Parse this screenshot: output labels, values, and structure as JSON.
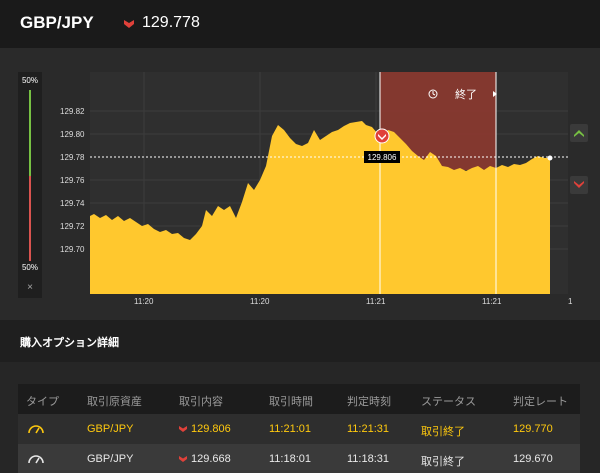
{
  "header": {
    "pair": "GBP/JPY",
    "rate": "129.778",
    "rate_direction": "down",
    "down_color": "#e0413a"
  },
  "gauge": {
    "top_label": "50%",
    "bottom_label": "50%",
    "close": "×",
    "up_fraction": 0.5,
    "down_fraction": 0.5
  },
  "chart": {
    "y_ticks": [
      "129.82",
      "129.80",
      "129.78",
      "129.76",
      "129.74",
      "129.72",
      "129.70"
    ],
    "x_ticks": [
      "11:20",
      "11:20",
      "11:21",
      "11:21"
    ],
    "window_label": "終了",
    "entry_label": "129.806",
    "area_color": "#ffc82e",
    "window_color": "#8b3a30"
  },
  "side_buttons": {
    "up_color": "#77c043",
    "down_color": "#e0413a"
  },
  "details": {
    "title": "購入オプション詳細",
    "columns": [
      "タイプ",
      "取引原資産",
      "取引内容",
      "取引時間",
      "判定時刻",
      "ステータス",
      "判定レート"
    ],
    "rows": [
      {
        "type_icon": "gauge-icon",
        "asset": "GBP/JPY",
        "direction": "down",
        "entry": "129.806",
        "trade_time": "11:21:01",
        "judge_time": "11:21:31",
        "status": "取引終了",
        "judge_rate": "129.770",
        "highlight": true
      },
      {
        "type_icon": "gauge-icon",
        "asset": "GBP/JPY",
        "direction": "down",
        "entry": "129.668",
        "trade_time": "11:18:01",
        "judge_time": "11:18:31",
        "status": "取引終了",
        "judge_rate": "129.670",
        "highlight": false
      }
    ]
  }
}
